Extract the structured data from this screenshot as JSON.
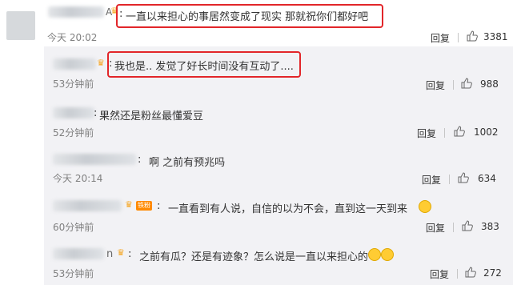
{
  "comments": [
    {
      "name_fragment": "A",
      "colon": ":",
      "text": "一直以来担心的事居然变成了现实 那就祝你们都好吧",
      "time": "今天 20:02",
      "reply": "回复",
      "likes": "3381"
    },
    {
      "name_fragment": "",
      "colon": ":",
      "text": "我也是.. 发觉了好长时间没有互动了....",
      "time": "53分钟前",
      "reply": "回复",
      "likes": "988"
    },
    {
      "name_fragment": "",
      "colon": ":",
      "text": "果然还是粉丝最懂爱豆",
      "time": "52分钟前",
      "reply": "回复",
      "likes": "1002"
    },
    {
      "name_fragment": "",
      "colon": ":",
      "text": "啊 之前有预兆吗",
      "time": "今天 20:14",
      "reply": "回复",
      "likes": "634"
    },
    {
      "name_fragment": "",
      "colon": ":",
      "badge": "铁粉",
      "text": "一直看到有人说，自信的以为不会，直到这一天到来",
      "time": "60分钟前",
      "reply": "回复",
      "likes": "383"
    },
    {
      "name_fragment": "n",
      "colon": ":",
      "text": "之前有瓜？还是有迹象？怎么说是一直以来担心的",
      "time": "53分钟前",
      "reply": "回复",
      "likes": "272"
    }
  ],
  "colors": {
    "highlight": "#e2262a",
    "subthread_bg": "#f2f2f5"
  },
  "icons": {
    "like": "thumbs-up-icon",
    "crown": "crown-icon",
    "emoji": "emoji-icon"
  }
}
